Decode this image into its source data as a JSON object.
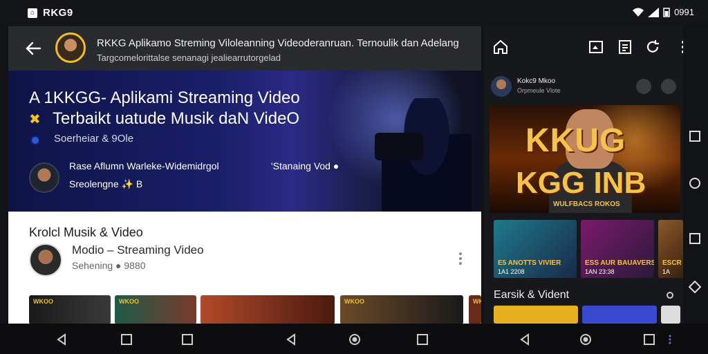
{
  "status_bar": {
    "app_name": "RKG9",
    "app_badge": "⌂",
    "time": "0991"
  },
  "left_pane": {
    "header": {
      "title": "RKKG Aplikamo Streming Viloleanning Videoderanruan. Ternoulik dan Adelang",
      "subtitle": "Targcomelorittalse senanagi jealiearrutorgelad"
    },
    "hero": {
      "title_line1": "A 1KKGG- Aplikami Streaming Video",
      "title_line2": "Terbaikt uatude Musik daN VideO",
      "mark": "✖",
      "subtitle": "Soerheiar & 9Ole",
      "channel": "Rase Aflumn Warleke-Widemidrgol",
      "tag": "'Stanaing Vod ●",
      "views": "Sreolengne ✨ B"
    },
    "card": {
      "title": "Krolcl  Musik & Video",
      "subtitle": "Modio – Streaming Video",
      "meta": "Sehening ● 9880",
      "thumbs": [
        {
          "label": "WKOO"
        },
        {
          "label": "WKOO"
        },
        {
          "label": ""
        },
        {
          "label": "WKOO"
        },
        {
          "label": "WKOO"
        }
      ]
    }
  },
  "right_pane": {
    "channel_name": "Kokc9 Mkoo",
    "channel_sub": "Orpmeule Vlote",
    "banner": {
      "line1": "KKUG",
      "line2": "KGG INB",
      "sub": "WULFBACS ROKOS"
    },
    "cards": [
      {
        "title": "E5 ANOTTS VIVIER",
        "date": "1A1 2208"
      },
      {
        "title": "ESS AUR BAUAVERS",
        "date": "1AN 23:38"
      },
      {
        "title": "ESCR",
        "date": "1A"
      }
    ],
    "section_title": "Earsik & Vident"
  },
  "colors": {
    "accent": "#f2c21a",
    "hero_blue": "#1a1f6a",
    "banner_gold": "#f6c34a"
  }
}
